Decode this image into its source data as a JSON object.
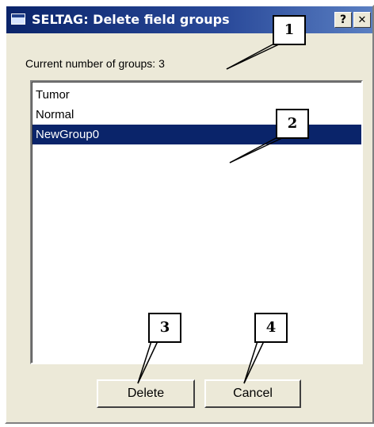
{
  "window": {
    "title": "SELTAG: Delete field groups",
    "help_label": "?",
    "close_label": "✕"
  },
  "count_label": "Current number of groups: 3",
  "groups": [
    {
      "label": "Tumor",
      "selected": false
    },
    {
      "label": "Normal",
      "selected": false
    },
    {
      "label": "NewGroup0",
      "selected": true
    }
  ],
  "buttons": {
    "delete_label": "Delete",
    "cancel_label": "Cancel"
  },
  "callouts": [
    "1",
    "2",
    "3",
    "4"
  ],
  "colors": {
    "titlebar": "#0a246a",
    "selection": "#0a246a",
    "dialog_bg": "#ece9d8"
  }
}
